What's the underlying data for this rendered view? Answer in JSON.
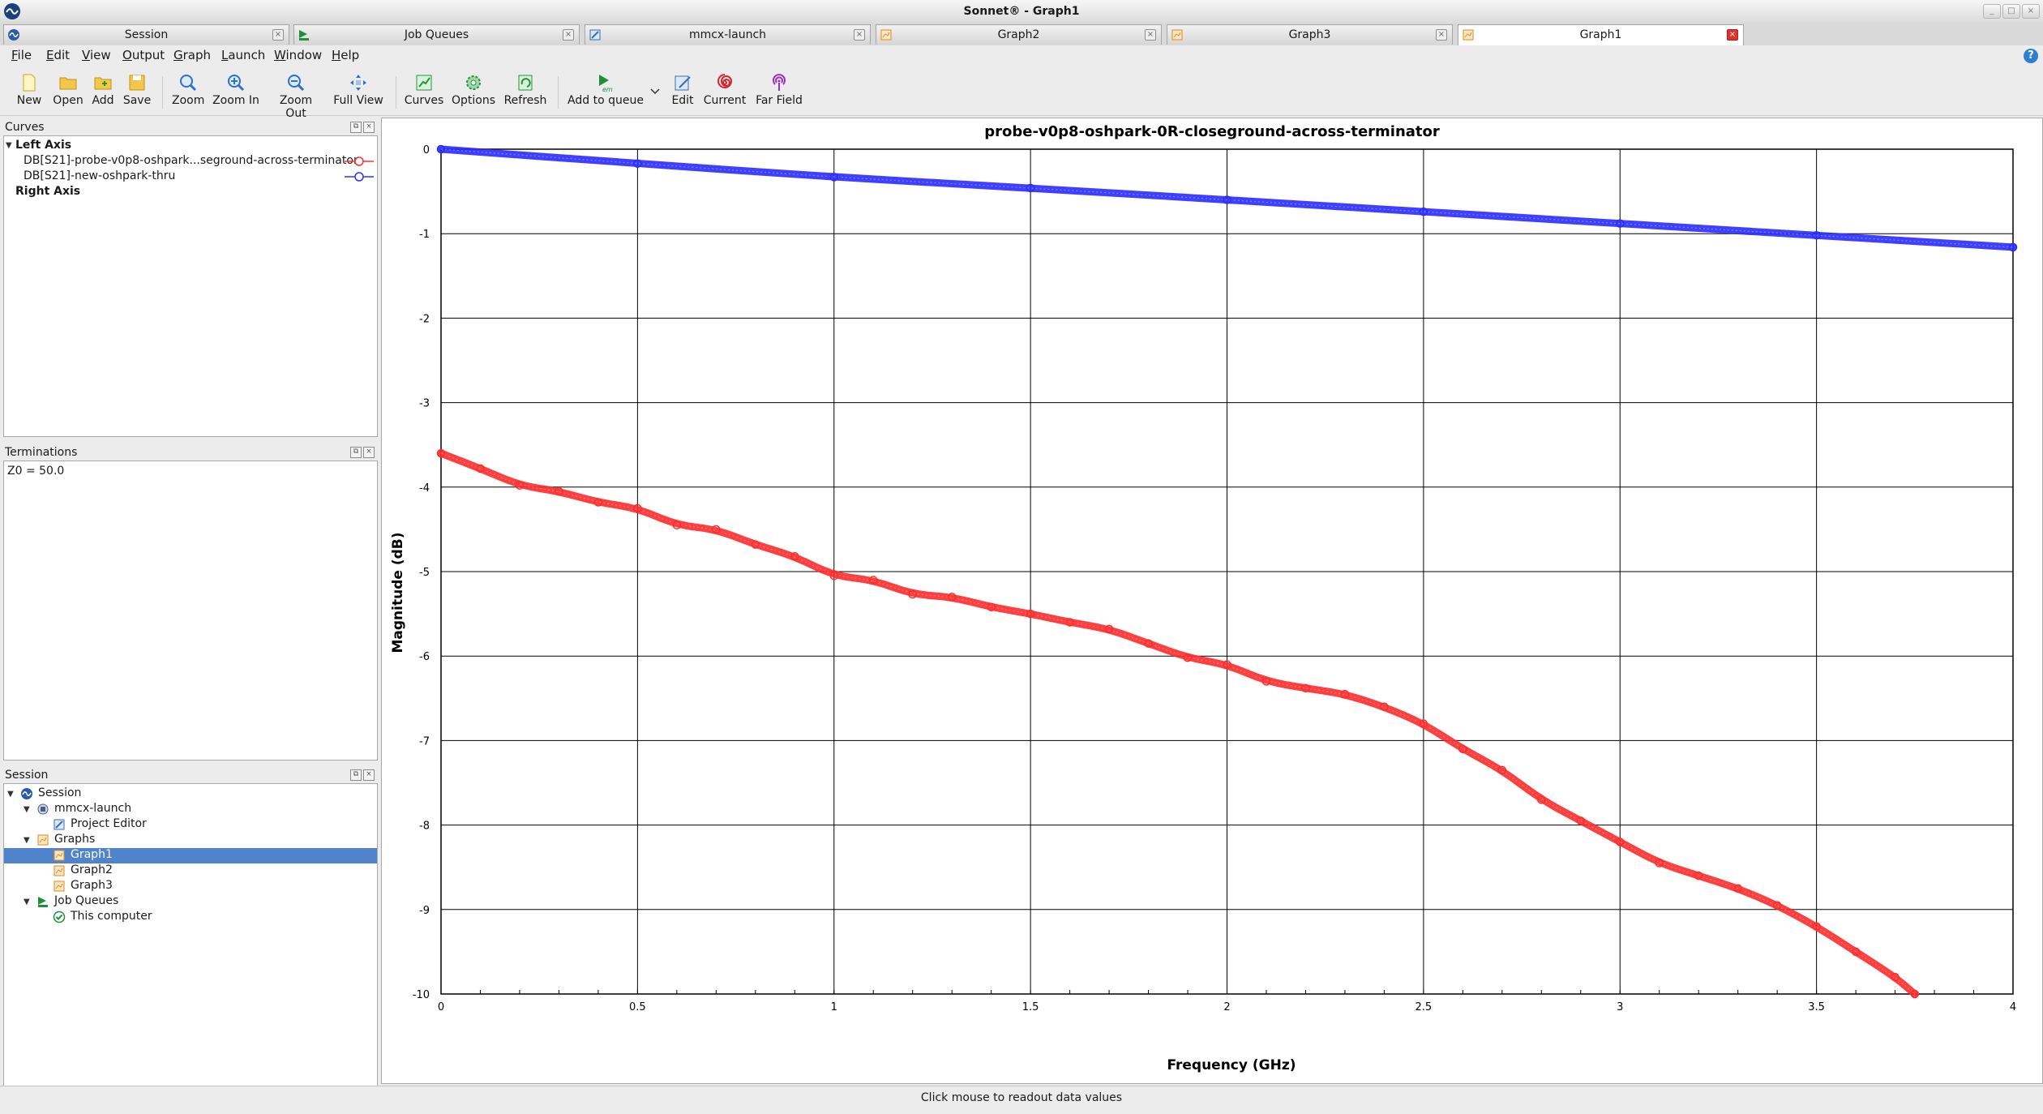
{
  "window": {
    "title": "Sonnet® - Graph1"
  },
  "tabs": [
    {
      "label": "Session",
      "icon": "sonnet-logo-icon",
      "active": false
    },
    {
      "label": "Job Queues",
      "icon": "job-queue-icon",
      "active": false
    },
    {
      "label": "mmcx-launch",
      "icon": "project-editor-icon",
      "active": false
    },
    {
      "label": "Graph2",
      "icon": "graph-icon",
      "active": false
    },
    {
      "label": "Graph3",
      "icon": "graph-icon",
      "active": false
    },
    {
      "label": "Graph1",
      "icon": "graph-icon",
      "active": true
    }
  ],
  "menu": [
    "File",
    "Edit",
    "View",
    "Output",
    "Graph",
    "Launch",
    "Window",
    "Help"
  ],
  "toolbar": {
    "new": "New",
    "open": "Open",
    "add": "Add",
    "save": "Save",
    "zoom": "Zoom",
    "zoom_in": "Zoom In",
    "zoom_out": "Zoom Out",
    "full_view": "Full View",
    "curves": "Curves",
    "options": "Options",
    "refresh": "Refresh",
    "add_to_queue": "Add to queue",
    "edit": "Edit",
    "current": "Current",
    "far_field": "Far Field"
  },
  "curves_panel": {
    "title": "Curves",
    "left_axis": "Left Axis",
    "right_axis": "Right Axis",
    "items": [
      {
        "label": "DB[S21]-probe-v0p8-oshpark...seground-across-terminator",
        "color": "#ff3030"
      },
      {
        "label": "DB[S21]-new-oshpark-thru",
        "color": "#3030ff"
      }
    ]
  },
  "terminations_panel": {
    "title": "Terminations",
    "value": "Z0 = 50.0"
  },
  "session_panel": {
    "title": "Session",
    "root": "Session",
    "project": "mmcx-launch",
    "project_editor": "Project Editor",
    "graphs": "Graphs",
    "graph_items": [
      "Graph1",
      "Graph2",
      "Graph3"
    ],
    "job_queues": "Job Queues",
    "this_computer": "This computer",
    "selected": "Graph1"
  },
  "status": {
    "text": "Click mouse to readout data values"
  },
  "chart_data": {
    "type": "line",
    "title": "probe-v0p8-oshpark-0R-closeground-across-terminator",
    "xlabel": "Frequency (GHz)",
    "ylabel": "Magnitude (dB)",
    "xlim": [
      0,
      4
    ],
    "ylim": [
      -10,
      0
    ],
    "xticks": [
      "0",
      "0.5",
      "1",
      "1.5",
      "2",
      "2.5",
      "3",
      "3.5",
      "4"
    ],
    "yticks": [
      "0",
      "-1",
      "-2",
      "-3",
      "-4",
      "-5",
      "-6",
      "-7",
      "-8",
      "-9",
      "-10"
    ],
    "grid": true,
    "series": [
      {
        "name": "DB[S21]-probe-v0p8-oshpark...seground-across-terminator",
        "color": "#ff2a2a",
        "x": [
          0,
          0.1,
          0.2,
          0.3,
          0.4,
          0.5,
          0.6,
          0.7,
          0.8,
          0.9,
          1.0,
          1.1,
          1.2,
          1.3,
          1.4,
          1.5,
          1.6,
          1.7,
          1.8,
          1.9,
          2.0,
          2.1,
          2.2,
          2.3,
          2.4,
          2.5,
          2.6,
          2.7,
          2.8,
          2.9,
          3.0,
          3.1,
          3.2,
          3.3,
          3.4,
          3.5,
          3.6,
          3.7,
          3.75
        ],
        "y": [
          -3.6,
          -3.78,
          -3.98,
          -4.05,
          -4.18,
          -4.25,
          -4.45,
          -4.5,
          -4.68,
          -4.82,
          -5.05,
          -5.1,
          -5.27,
          -5.3,
          -5.42,
          -5.5,
          -5.6,
          -5.68,
          -5.85,
          -6.02,
          -6.1,
          -6.3,
          -6.38,
          -6.45,
          -6.6,
          -6.8,
          -7.1,
          -7.35,
          -7.7,
          -7.95,
          -8.2,
          -8.45,
          -8.6,
          -8.75,
          -8.95,
          -9.2,
          -9.5,
          -9.8,
          -10.0
        ]
      },
      {
        "name": "DB[S21]-new-oshpark-thru",
        "color": "#2a2aff",
        "x": [
          0,
          0.5,
          1.0,
          1.5,
          2.0,
          2.5,
          3.0,
          3.5,
          4.0
        ],
        "y": [
          0,
          -0.17,
          -0.33,
          -0.46,
          -0.6,
          -0.74,
          -0.88,
          -1.02,
          -1.16
        ]
      }
    ]
  }
}
